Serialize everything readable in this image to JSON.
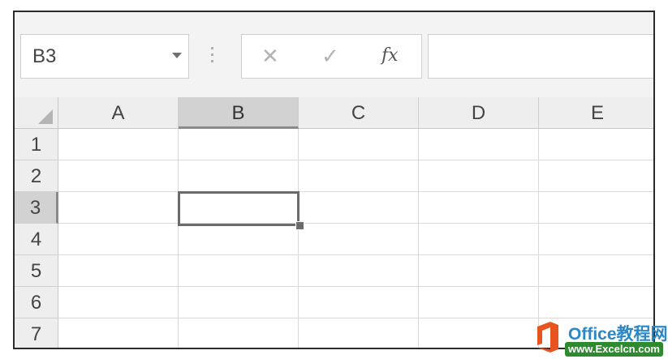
{
  "name_box": {
    "value": "B3"
  },
  "formula_bar": {
    "cancel_glyph": "✕",
    "enter_glyph": "✓",
    "fx_label": "fx",
    "content": ""
  },
  "columns": [
    "A",
    "B",
    "C",
    "D",
    "E"
  ],
  "rows": [
    "1",
    "2",
    "3",
    "4",
    "5",
    "6",
    "7"
  ],
  "selected_cell": {
    "column": "B",
    "row": "3"
  },
  "watermark": {
    "title": "Office教程网",
    "url": "www.Excelcn.com"
  },
  "colors": {
    "header_bg": "#eeeeee",
    "header_selected_bg": "#d2d2d2",
    "gridline": "#d9d9d9",
    "selection_border": "#6b6b6b"
  }
}
